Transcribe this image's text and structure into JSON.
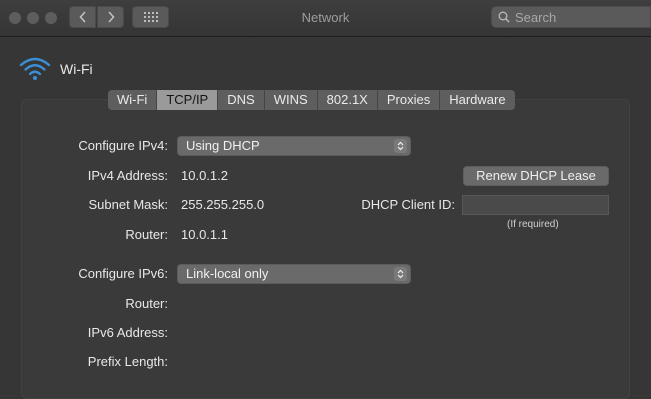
{
  "window": {
    "title": "Network"
  },
  "toolbar": {
    "search_placeholder": "Search"
  },
  "interface": {
    "name": "Wi-Fi"
  },
  "tabs": [
    {
      "label": "Wi-Fi",
      "active": false
    },
    {
      "label": "TCP/IP",
      "active": true
    },
    {
      "label": "DNS",
      "active": false
    },
    {
      "label": "WINS",
      "active": false
    },
    {
      "label": "802.1X",
      "active": false
    },
    {
      "label": "Proxies",
      "active": false
    },
    {
      "label": "Hardware",
      "active": false
    }
  ],
  "ipv4": {
    "configure_label": "Configure IPv4:",
    "configure_value": "Using DHCP",
    "address_label": "IPv4 Address:",
    "address_value": "10.0.1.2",
    "subnet_label": "Subnet Mask:",
    "subnet_value": "255.255.255.0",
    "router_label": "Router:",
    "router_value": "10.0.1.1",
    "renew_button": "Renew DHCP Lease",
    "client_id_label": "DHCP Client ID:",
    "client_id_value": "",
    "client_id_hint": "(If required)"
  },
  "ipv6": {
    "configure_label": "Configure IPv6:",
    "configure_value": "Link-local only",
    "router_label": "Router:",
    "address_label": "IPv6 Address:",
    "prefix_label": "Prefix Length:"
  },
  "colors": {
    "window_bg": "#363636",
    "active_tab": "#9a9a9a",
    "wifi_icon": "#3b8fd6"
  }
}
